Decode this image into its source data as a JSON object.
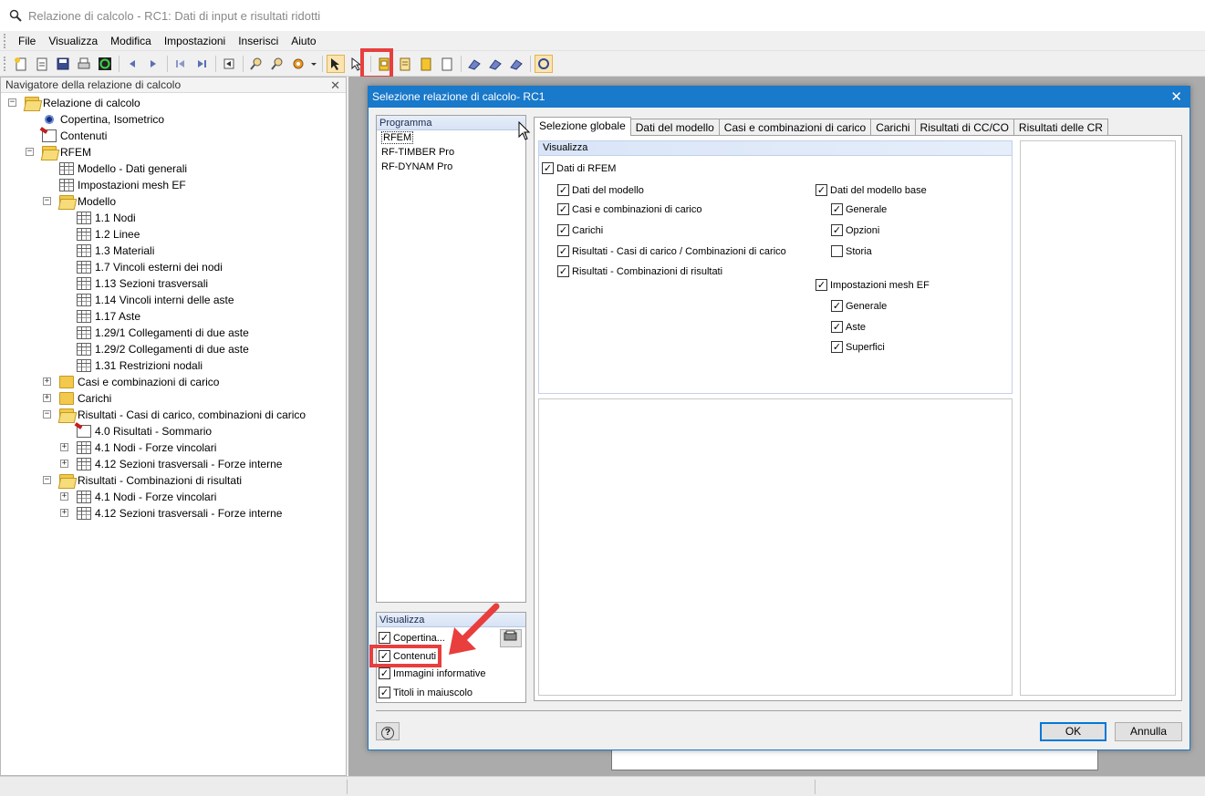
{
  "window": {
    "title": "Relazione di calcolo - RC1: Dati di input e risultati ridotti"
  },
  "menu": [
    "File",
    "Visualizza",
    "Modifica",
    "Impostazioni",
    "Inserisci",
    "Aiuto"
  ],
  "navigator": {
    "title": "Navigatore della relazione di calcolo",
    "close": "✕",
    "items": [
      {
        "label": "Relazione di calcolo",
        "icon": "folder-open-icon",
        "level": 0,
        "expander": "−"
      },
      {
        "label": "Copertina, Isometrico",
        "icon": "eye-icon",
        "level": 1,
        "expander": ""
      },
      {
        "label": "Contenuti",
        "icon": "contents-icon",
        "level": 1,
        "expander": ""
      },
      {
        "label": "RFEM",
        "icon": "folder-open-icon",
        "level": 1,
        "expander": "−"
      },
      {
        "label": "Modello - Dati generali",
        "icon": "table-icon",
        "level": 2,
        "expander": ""
      },
      {
        "label": "Impostazioni mesh EF",
        "icon": "table-icon",
        "level": 2,
        "expander": ""
      },
      {
        "label": "Modello",
        "icon": "folder-open-icon",
        "level": 2,
        "expander": "−"
      },
      {
        "label": "1.1 Nodi",
        "icon": "table-icon",
        "level": 3,
        "expander": ""
      },
      {
        "label": "1.2 Linee",
        "icon": "table-icon",
        "level": 3,
        "expander": ""
      },
      {
        "label": "1.3 Materiali",
        "icon": "table-icon",
        "level": 3,
        "expander": ""
      },
      {
        "label": "1.7 Vincoli esterni dei nodi",
        "icon": "table-icon",
        "level": 3,
        "expander": ""
      },
      {
        "label": "1.13 Sezioni trasversali",
        "icon": "table-icon",
        "level": 3,
        "expander": ""
      },
      {
        "label": "1.14 Vincoli interni delle aste",
        "icon": "table-icon",
        "level": 3,
        "expander": ""
      },
      {
        "label": "1.17 Aste",
        "icon": "table-icon",
        "level": 3,
        "expander": ""
      },
      {
        "label": "1.29/1 Collegamenti di due aste",
        "icon": "table-icon",
        "level": 3,
        "expander": ""
      },
      {
        "label": "1.29/2 Collegamenti di due aste",
        "icon": "table-icon",
        "level": 3,
        "expander": ""
      },
      {
        "label": "1.31 Restrizioni nodali",
        "icon": "table-icon",
        "level": 3,
        "expander": ""
      },
      {
        "label": "Casi e combinazioni di carico",
        "icon": "folder-icon",
        "level": 2,
        "expander": "+"
      },
      {
        "label": "Carichi",
        "icon": "folder-icon",
        "level": 2,
        "expander": "+"
      },
      {
        "label": "Risultati - Casi di carico, combinazioni di carico",
        "icon": "folder-open-icon",
        "level": 2,
        "expander": "−"
      },
      {
        "label": "4.0 Risultati - Sommario",
        "icon": "contents-icon",
        "level": 3,
        "expander": ""
      },
      {
        "label": "4.1 Nodi - Forze vincolari",
        "icon": "table-icon",
        "level": 3,
        "expander": "+"
      },
      {
        "label": "4.12 Sezioni trasversali - Forze interne",
        "icon": "table-icon",
        "level": 3,
        "expander": "+"
      },
      {
        "label": "Risultati - Combinazioni di risultati",
        "icon": "folder-open-icon",
        "level": 2,
        "expander": "−"
      },
      {
        "label": "4.1 Nodi - Forze vincolari",
        "icon": "table-icon",
        "level": 3,
        "expander": "+"
      },
      {
        "label": "4.12 Sezioni trasversali - Forze interne",
        "icon": "table-icon",
        "level": 3,
        "expander": "+"
      }
    ]
  },
  "dialog": {
    "title": "Selezione relazione di calcolo- RC1",
    "close": "✕",
    "programs_header": "Programma",
    "programs": [
      "RFEM",
      "RF-TIMBER Pro",
      "RF-DYNAM Pro"
    ],
    "left_display": {
      "header": "Visualizza",
      "items": [
        {
          "label": "Copertina...",
          "checked": true
        },
        {
          "label": "Contenuti",
          "checked": true
        },
        {
          "label": "Immagini informative",
          "checked": true
        },
        {
          "label": "Titoli in maiuscolo",
          "checked": true
        }
      ]
    },
    "tabs": [
      "Selezione globale",
      "Dati del modello",
      "Casi e combinazioni di carico",
      "Carichi",
      "Risultati di CC/CO",
      "Risultati delle CR"
    ],
    "group_header": "Visualizza",
    "checks": {
      "rfem": {
        "label": "Dati di RFEM",
        "checked": true
      },
      "col1": [
        {
          "label": "Dati del modello",
          "checked": true
        },
        {
          "label": "Casi e combinazioni di carico",
          "checked": true
        },
        {
          "label": "Carichi",
          "checked": true
        },
        {
          "label": "Risultati - Casi di carico / Combinazioni di carico",
          "checked": true
        },
        {
          "label": "Risultati - Combinazioni di risultati",
          "checked": true
        }
      ],
      "base": {
        "label": "Dati del modello base",
        "checked": true
      },
      "base_items": [
        {
          "label": "Generale",
          "checked": true
        },
        {
          "label": "Opzioni",
          "checked": true
        },
        {
          "label": "Storia",
          "checked": false
        }
      ],
      "mesh": {
        "label": "Impostazioni mesh EF",
        "checked": true
      },
      "mesh_items": [
        {
          "label": "Generale",
          "checked": true
        },
        {
          "label": "Aste",
          "checked": true
        },
        {
          "label": "Superfici",
          "checked": true
        }
      ]
    },
    "help": "?",
    "ok": "OK",
    "cancel": "Annulla"
  },
  "colors": {
    "accent": "#1979ca",
    "highlight": "#e83e3e"
  }
}
